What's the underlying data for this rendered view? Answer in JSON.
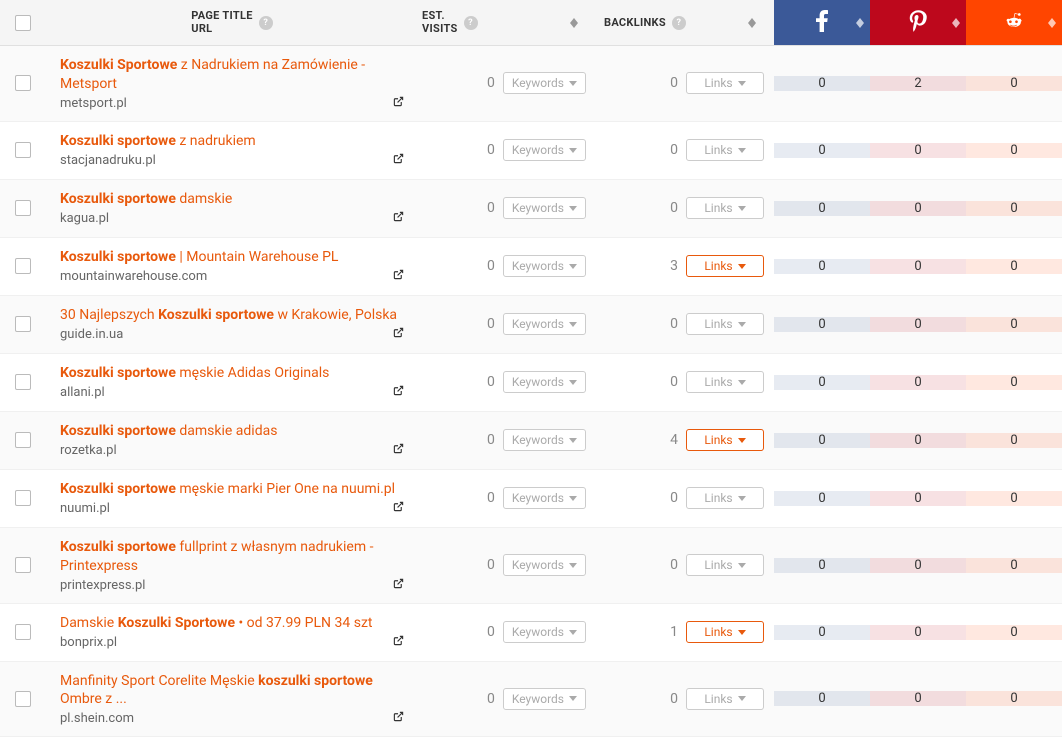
{
  "headers": {
    "page_title": "PAGE TITLE",
    "url": "URL",
    "est_visits_l1": "EST.",
    "est_visits_l2": "VISITS",
    "backlinks": "BACKLINKS"
  },
  "labels": {
    "keywords_btn": "Keywords",
    "links_btn": "Links"
  },
  "rows": [
    {
      "title_pre": "",
      "title_hl": "Koszulki Sportowe",
      "title_hl_bold": true,
      "title_post": " z Nadrukiem na Zamówienie - Metsport",
      "url": "metsport.pl",
      "visits": 0,
      "backlinks": 0,
      "links_active": false,
      "fb": 0,
      "pin": 2,
      "red": 0
    },
    {
      "title_pre": "",
      "title_hl": "Koszulki sportowe",
      "title_hl_bold": true,
      "title_post": " z nadrukiem",
      "url": "stacjanadruku.pl",
      "visits": 0,
      "backlinks": 0,
      "links_active": false,
      "fb": 0,
      "pin": 0,
      "red": 0
    },
    {
      "title_pre": "",
      "title_hl": "Koszulki sportowe",
      "title_hl_bold": true,
      "title_post": " damskie",
      "url": "kagua.pl",
      "visits": 0,
      "backlinks": 0,
      "links_active": false,
      "fb": 0,
      "pin": 0,
      "red": 0
    },
    {
      "title_pre": "",
      "title_hl": "Koszulki sportowe",
      "title_hl_bold": true,
      "title_post": " | Mountain Warehouse PL",
      "url": "mountainwarehouse.com",
      "visits": 0,
      "backlinks": 3,
      "links_active": true,
      "fb": 0,
      "pin": 0,
      "red": 0
    },
    {
      "title_pre": "30 Najlepszych ",
      "title_hl": "Koszulki sportowe",
      "title_hl_bold": true,
      "title_post": " w Krakowie, Polska",
      "url": "guide.in.ua",
      "visits": 0,
      "backlinks": 0,
      "links_active": false,
      "fb": 0,
      "pin": 0,
      "red": 0
    },
    {
      "title_pre": "",
      "title_hl": "Koszulki sportowe",
      "title_hl_bold": true,
      "title_post": " męskie Adidas Originals",
      "url": "allani.pl",
      "visits": 0,
      "backlinks": 0,
      "links_active": false,
      "fb": 0,
      "pin": 0,
      "red": 0
    },
    {
      "title_pre": "",
      "title_hl": "Koszulki sportowe",
      "title_hl_bold": true,
      "title_post": " damskie adidas",
      "url": "rozetka.pl",
      "visits": 0,
      "backlinks": 4,
      "links_active": true,
      "fb": 0,
      "pin": 0,
      "red": 0
    },
    {
      "title_pre": "",
      "title_hl": "Koszulki sportowe",
      "title_hl_bold": true,
      "title_post": " męskie marki Pier One na nuumi.pl",
      "url": "nuumi.pl",
      "visits": 0,
      "backlinks": 0,
      "links_active": false,
      "fb": 0,
      "pin": 0,
      "red": 0
    },
    {
      "title_pre": "",
      "title_hl": "Koszulki sportowe",
      "title_hl_bold": true,
      "title_post": " fullprint z własnym nadrukiem - Printexpress",
      "url": "printexpress.pl",
      "visits": 0,
      "backlinks": 0,
      "links_active": false,
      "fb": 0,
      "pin": 0,
      "red": 0
    },
    {
      "title_pre": "Damskie ",
      "title_hl": "Koszulki Sportowe",
      "title_hl_bold": true,
      "title_post": " • od 37.99 PLN 34 szt",
      "url": "bonprix.pl",
      "visits": 0,
      "backlinks": 1,
      "links_active": true,
      "fb": 0,
      "pin": 0,
      "red": 0
    },
    {
      "title_pre": "Manfinity Sport Corelite Męskie ",
      "title_hl": "koszulki sportowe",
      "title_hl_bold": true,
      "title_post": " Ombre z ...",
      "url": "pl.shein.com",
      "visits": 0,
      "backlinks": 0,
      "links_active": false,
      "fb": 0,
      "pin": 0,
      "red": 0
    }
  ]
}
